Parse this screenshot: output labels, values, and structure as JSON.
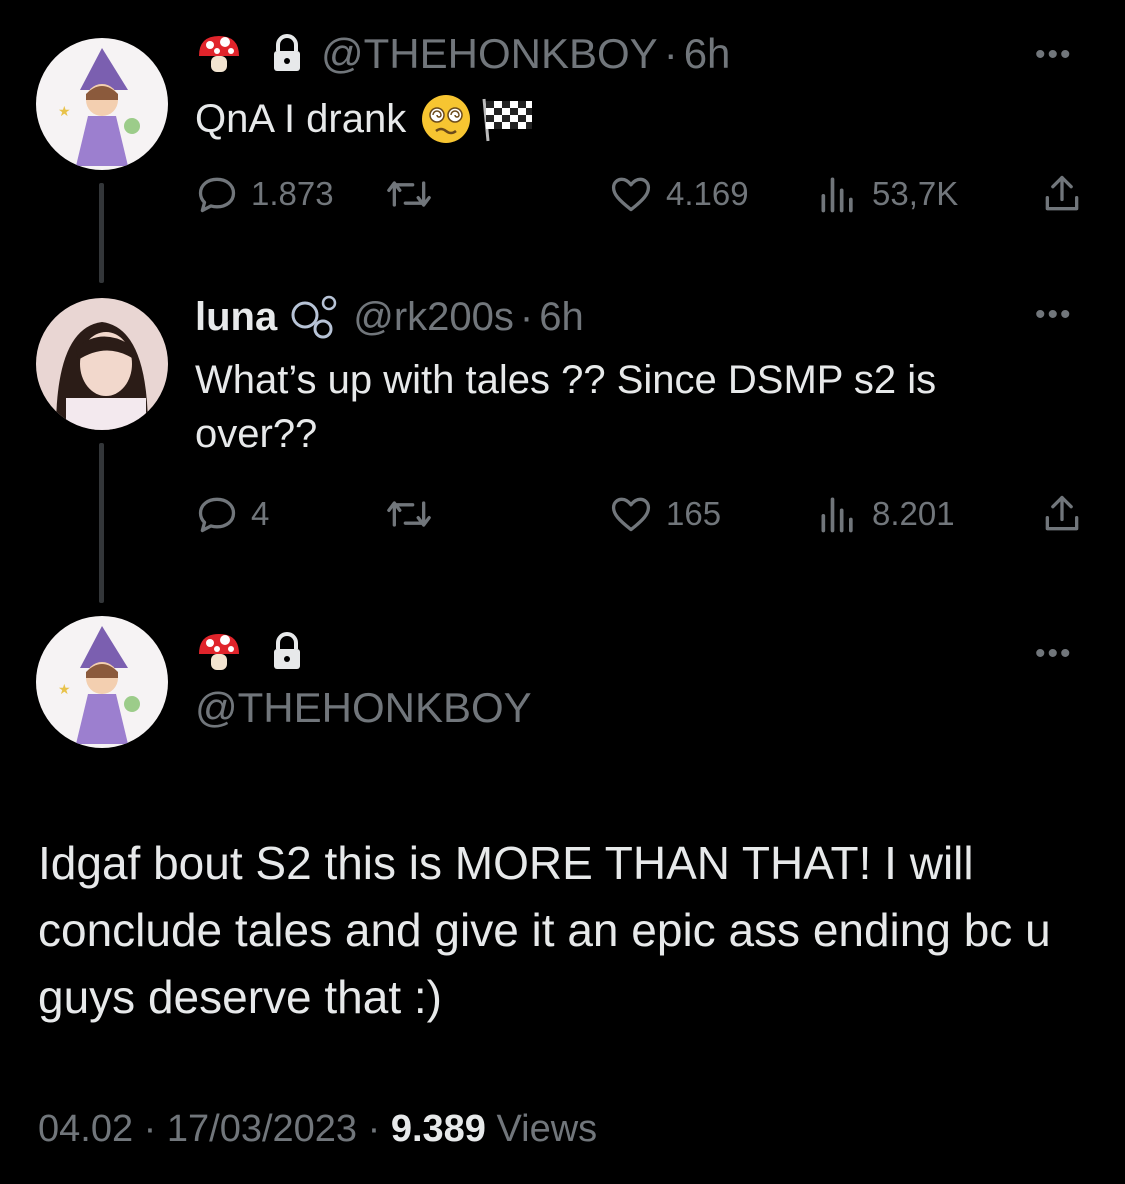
{
  "tweet1": {
    "handle": "@THEHONKBOY",
    "time": "6h",
    "text": "QnA I drank",
    "icons": [
      "mushroom-icon",
      "lock-icon",
      "dizzy-face-icon",
      "checkered-flag-icon"
    ],
    "replies": "1.873",
    "retweets": "",
    "likes": "4.169",
    "views": "53,7K"
  },
  "tweet2": {
    "name": "luna",
    "handle": "@rk200s",
    "time": "6h",
    "text": "What’s up with tales ?? Since DSMP s2 is over??",
    "replies": "4",
    "retweets": "",
    "likes": "165",
    "views": "8.201"
  },
  "main_tweet": {
    "handle": "@THEHONKBOY",
    "text": "Idgaf bout S2 this is MORE THAN THAT! I will conclude tales and give it an epic ass ending bc u guys deserve that :)",
    "time": "04.02",
    "date": "17/03/2023",
    "views_count": "9.389",
    "views_label": "Views"
  },
  "separator": "·",
  "colors": {
    "background": "#000000",
    "text": "#e7e9ea",
    "muted": "#71767b",
    "thread_line": "#333639"
  }
}
